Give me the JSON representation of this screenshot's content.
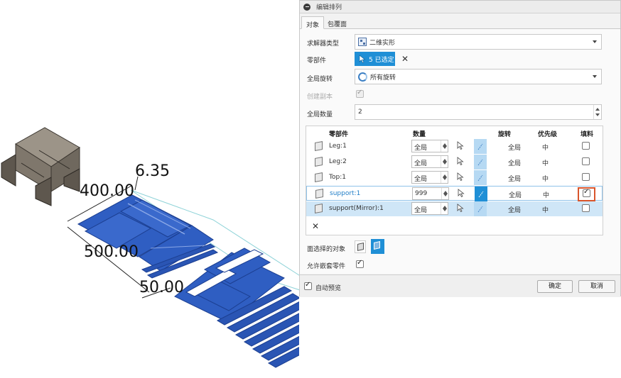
{
  "viewport": {
    "dims": [
      "6.35",
      "400.00",
      "500.00",
      "50.00"
    ],
    "colors": {
      "part": "#2f5ec2",
      "part_edge": "#1c3f91",
      "model": "#8a8278",
      "boundary": "#8fd3d8"
    }
  },
  "dialog": {
    "title": "编辑排列",
    "tabs": [
      "对象",
      "包覆面"
    ],
    "solver": {
      "label": "求解器类型",
      "value": "二维实形"
    },
    "parts": {
      "label": "零部件",
      "select_text": "5 已选定"
    },
    "global_rotation": {
      "label": "全局旋转",
      "value": "所有旋转"
    },
    "create_copy": {
      "label": "创建副本"
    },
    "global_quantity": {
      "label": "全局数量",
      "value": "2"
    },
    "table": {
      "headers": [
        "零部件",
        "数量",
        "旋转",
        "优先级",
        "填料"
      ],
      "rows": [
        {
          "name": "Leg:1",
          "qty": "全局",
          "rotation": "全局",
          "priority": "中",
          "fill": false
        },
        {
          "name": "Leg:2",
          "qty": "全局",
          "rotation": "全局",
          "priority": "中",
          "fill": false
        },
        {
          "name": "Top:1",
          "qty": "全局",
          "rotation": "全局",
          "priority": "中",
          "fill": false
        },
        {
          "name": "support:1",
          "qty": "999",
          "rotation": "全局",
          "priority": "中",
          "fill": true
        },
        {
          "name": "support(Mirror):1",
          "qty": "全局",
          "rotation": "全局",
          "priority": "中",
          "fill": false
        }
      ]
    },
    "faces": {
      "label": "面选择的对象"
    },
    "allow_nesting": {
      "label": "允许嵌套零件"
    },
    "auto_preview": {
      "label": "自动预览"
    },
    "ok": "确定",
    "cancel": "取消"
  }
}
